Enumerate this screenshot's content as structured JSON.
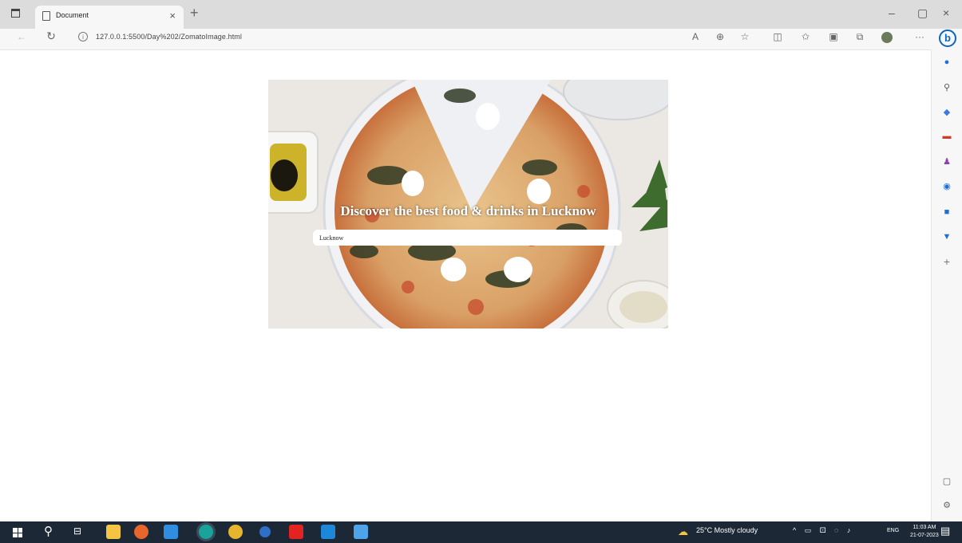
{
  "browser": {
    "tab_title": "Document",
    "tab_close": "×",
    "new_tab": "+",
    "url": "127.0.0.1:5500/Day%202/ZomatoImage.html",
    "window_controls": [
      "–",
      "▢",
      "×"
    ],
    "bing_label": "b"
  },
  "page": {
    "heading": "Discover the best food & drinks in Lucknow",
    "search_value": "Lucknow"
  },
  "taskbar": {
    "weather": "25°C  Mostly cloudy",
    "lang": "ENG",
    "time": "11:03 AM",
    "date": "21-07-2023"
  },
  "colors": {
    "taskbar": "#1c2836",
    "accent": "#0a66c2"
  }
}
